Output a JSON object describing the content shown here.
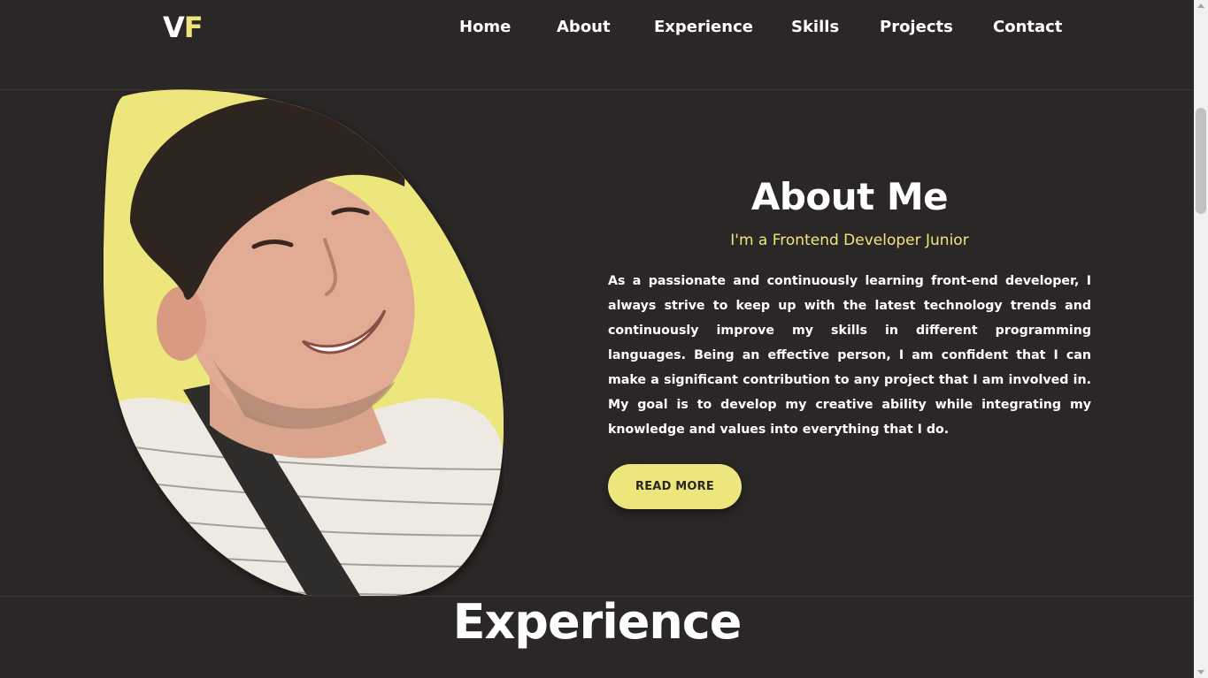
{
  "logo": {
    "part1": "V",
    "part2": "F"
  },
  "nav": {
    "home": "Home",
    "about": "About",
    "experience": "Experience",
    "skills": "Skills",
    "projects": "Projects",
    "contact": "Contact"
  },
  "about": {
    "title": "About Me",
    "subtitle": "I'm a Frontend Developer Junior",
    "text": "As a passionate and continuously learning front-end developer, I always strive to keep up with the latest technology trends and continuously improve my skills in different programming languages. Being an effective person, I am confident that I can make a significant contribution to any project that I am involved in. My goal is to develop my creative ability while integrating my knowledge and values into everything that I do.",
    "button": "READ MORE"
  },
  "experience": {
    "title": "Experience"
  },
  "colors": {
    "background": "#2b2727",
    "accent": "#ede67d",
    "text": "#ffffff"
  }
}
